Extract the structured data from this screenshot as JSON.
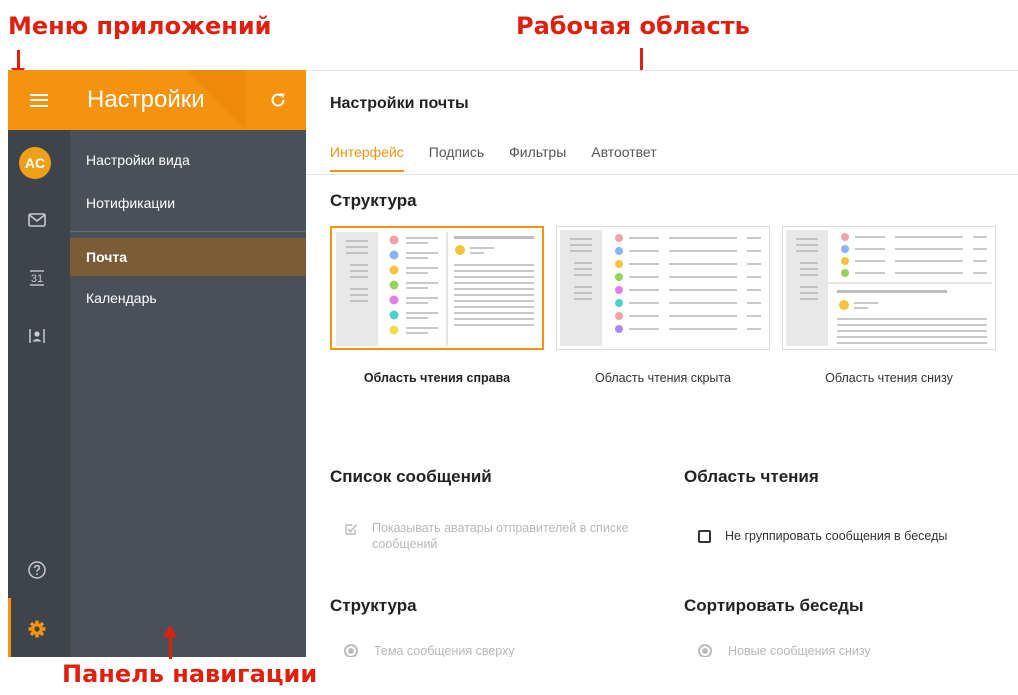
{
  "annotations": {
    "apps_menu": "Меню приложений",
    "workspace": "Рабочая область",
    "nav_panel": "Панель навигации"
  },
  "rail": {
    "avatar_initials": "AC",
    "icons": [
      "menu-icon",
      "mail-icon",
      "calendar-icon",
      "contacts-icon",
      "help-icon",
      "gear-icon"
    ],
    "calendar_day": "31",
    "accent_color": "#f5920f"
  },
  "nav": {
    "title": "Настройки",
    "items": [
      {
        "label": "Настройки вида"
      },
      {
        "label": "Нотификации"
      },
      {
        "label": "Почта",
        "active": true
      },
      {
        "label": "Календарь"
      }
    ]
  },
  "main": {
    "title": "Настройки почты",
    "tabs": [
      {
        "label": "Интерфейс",
        "active": true
      },
      {
        "label": "Подпись"
      },
      {
        "label": "Фильтры"
      },
      {
        "label": "Автоответ"
      }
    ],
    "structure_heading": "Структура",
    "layouts": [
      {
        "label": "Область чтения справа",
        "selected": true
      },
      {
        "label": "Область чтения скрыта"
      },
      {
        "label": "Область чтения снизу"
      }
    ],
    "message_list_heading": "Список сообщений",
    "show_avatars_label": "Показывать аватары отправителей в списке сообщений",
    "reading_area_heading": "Область чтения",
    "no_group_label": "Не группировать сообщения в беседы",
    "structure2_heading": "Структура",
    "topic_top_label": "Тема сообщения сверху",
    "sort_heading": "Сортировать беседы",
    "new_bottom_label": "Новые сообщения снизу"
  }
}
